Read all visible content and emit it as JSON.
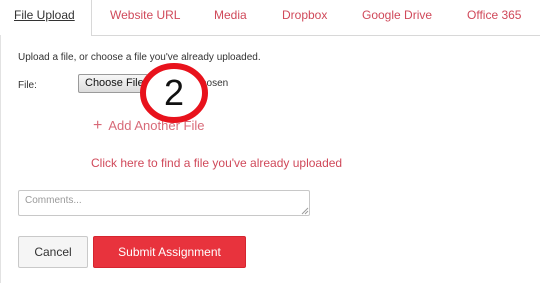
{
  "tabs": [
    {
      "label": "File Upload",
      "active": true
    },
    {
      "label": "Website URL",
      "active": false
    },
    {
      "label": "Media",
      "active": false
    },
    {
      "label": "Dropbox",
      "active": false
    },
    {
      "label": "Google Drive",
      "active": false
    },
    {
      "label": "Office 365",
      "active": false
    }
  ],
  "upload": {
    "instructions": "Upload a file, or choose a file you've already uploaded.",
    "file_label": "File:",
    "choose_button": "Choose File",
    "file_status": "chosen",
    "add_another": "Add Another File",
    "add_icon": "plus-icon",
    "find_link": "Click here to find a file you've already uploaded"
  },
  "comments": {
    "placeholder": "Comments..."
  },
  "actions": {
    "cancel": "Cancel",
    "submit": "Submit Assignment"
  },
  "annotation": {
    "number": "2"
  },
  "colors": {
    "accent": "#d0495a",
    "submit_bg": "#e8333d",
    "annotation_ring": "#e8121c"
  }
}
